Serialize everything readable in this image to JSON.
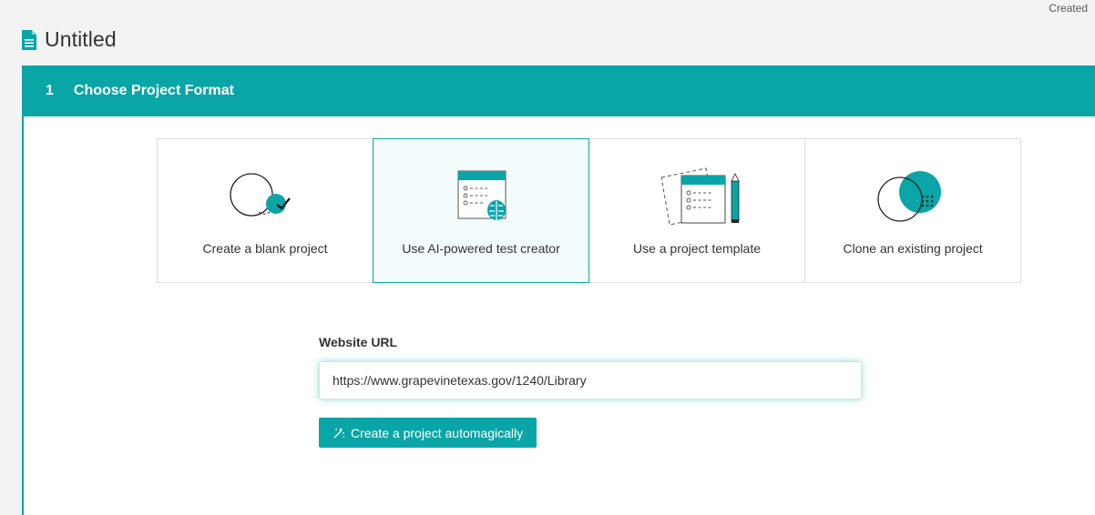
{
  "header": {
    "created_label": "Created",
    "title": "Untitled",
    "icon": "document-icon"
  },
  "step": {
    "number": "1",
    "title": "Choose Project Format"
  },
  "formats": [
    {
      "label": "Create a blank project",
      "icon": "blank-project-icon",
      "selected": false
    },
    {
      "label": "Use AI-powered test creator",
      "icon": "ai-test-creator-icon",
      "selected": true
    },
    {
      "label": "Use a project template",
      "icon": "project-template-icon",
      "selected": false
    },
    {
      "label": "Clone an existing project",
      "icon": "clone-project-icon",
      "selected": false
    }
  ],
  "url_form": {
    "label": "Website URL",
    "value": "https://www.grapevinetexas.gov/1240/Library",
    "button_label": "Create a project automagically",
    "button_icon": "magic-wand-icon"
  },
  "colors": {
    "accent": "#0aa5a6",
    "selected_card_bg": "#f3fcfc",
    "page_bg": "#f3f3f3"
  }
}
